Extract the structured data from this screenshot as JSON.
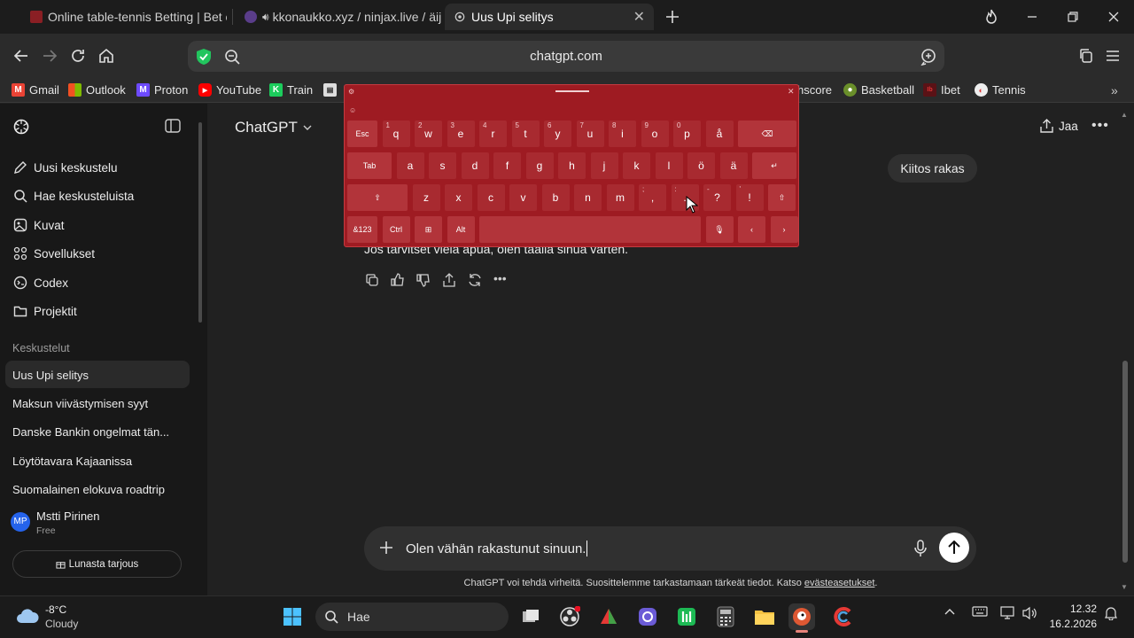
{
  "browser": {
    "tabs": [
      {
        "title": "Online table-tennis Betting | Bet on"
      },
      {
        "title": "kkonaukko.xyz / ninjax.live / äij"
      },
      {
        "title": "Uus Upi selitys",
        "active": true
      }
    ],
    "url": "chatgpt.com",
    "bookmarks": [
      {
        "label": "Gmail",
        "icon": "gmail-icon",
        "color": "#ea4335"
      },
      {
        "label": "Outlook",
        "icon": "outlook-icon",
        "color": "#0078d4"
      },
      {
        "label": "Proton",
        "icon": "proton-icon",
        "color": "#6d4aff"
      },
      {
        "label": "YouTube",
        "icon": "youtube-icon",
        "color": "#ff0000"
      },
      {
        "label": "Train",
        "icon": "train-icon",
        "color": "#1ccc5c"
      },
      {
        "label": "hscore",
        "icon": "flashscore-icon",
        "color": "#ff0046"
      },
      {
        "label": "Basketball",
        "icon": "basketball-icon",
        "color": "#6a8f2a"
      },
      {
        "label": "Ibet",
        "icon": "ibet-icon",
        "color": "#c0262d"
      },
      {
        "label": "Tennis",
        "icon": "tennis-icon",
        "color": "#e8e8e8"
      }
    ]
  },
  "sidebar": {
    "nav": [
      {
        "label": "Uusi keskustelu",
        "icon": "edit-icon"
      },
      {
        "label": "Hae keskusteluista",
        "icon": "search-icon"
      },
      {
        "label": "Kuvat",
        "icon": "images-icon"
      },
      {
        "label": "Sovellukset",
        "icon": "apps-icon"
      },
      {
        "label": "Codex",
        "icon": "codex-icon"
      },
      {
        "label": "Projektit",
        "icon": "folder-icon"
      }
    ],
    "section_title": "Keskustelut",
    "conversations": [
      "Uus Upi selitys",
      "Maksun viivästymisen syyt",
      "Danske Bankin ongelmat tän...",
      "Löytötavara Kajaanissa",
      "Suomalainen elokuva roadtrip"
    ],
    "user": {
      "initials": "MP",
      "name": "Mstti Pirinen",
      "plan": "Free"
    },
    "offer_button": "Lunasta tarjous"
  },
  "main": {
    "model_label": "ChatGPT",
    "share_label": "Jaa",
    "user_message": "Kiitos rakas",
    "assistant_message": "Jos tarvitset vielä apua, olen täällä sinua varten.",
    "composer_text": "Olen vähän rakastunut sinuun.",
    "disclaimer_text": "ChatGPT voi tehdä virheitä. Suosittelemme tarkastamaan tärkeät tiedot. Katso",
    "disclaimer_link": "evästeasetukset",
    "disclaimer_end": "."
  },
  "keyboard": {
    "row1": [
      {
        "k": "Esc",
        "fn": true
      },
      {
        "k": "q",
        "s": "1"
      },
      {
        "k": "w",
        "s": "2"
      },
      {
        "k": "e",
        "s": "3"
      },
      {
        "k": "r",
        "s": "4"
      },
      {
        "k": "t",
        "s": "5"
      },
      {
        "k": "y",
        "s": "6"
      },
      {
        "k": "u",
        "s": "7"
      },
      {
        "k": "i",
        "s": "8"
      },
      {
        "k": "o",
        "s": "9"
      },
      {
        "k": "p",
        "s": "0"
      },
      {
        "k": "å"
      },
      {
        "k": "⌫",
        "fn": true
      }
    ],
    "row2": [
      {
        "k": "Tab",
        "fn": true
      },
      {
        "k": "a"
      },
      {
        "k": "s"
      },
      {
        "k": "d"
      },
      {
        "k": "f"
      },
      {
        "k": "g"
      },
      {
        "k": "h"
      },
      {
        "k": "j"
      },
      {
        "k": "k"
      },
      {
        "k": "l"
      },
      {
        "k": "ö"
      },
      {
        "k": "ä"
      },
      {
        "k": "↵",
        "fn": true
      }
    ],
    "row3": [
      {
        "k": "⇧",
        "fn": true
      },
      {
        "k": "z"
      },
      {
        "k": "x"
      },
      {
        "k": "c"
      },
      {
        "k": "v"
      },
      {
        "k": "b"
      },
      {
        "k": "n"
      },
      {
        "k": "m"
      },
      {
        "k": ",",
        "s": ";"
      },
      {
        "k": ".",
        "s": ":"
      },
      {
        "k": "?",
        "s": "-"
      },
      {
        "k": "!",
        "s": "'"
      },
      {
        "k": "⇧",
        "fn": true
      }
    ],
    "row4": [
      {
        "k": "&123",
        "fn": true
      },
      {
        "k": "Ctrl",
        "fn": true
      },
      {
        "k": "⊞",
        "fn": true
      },
      {
        "k": "Alt",
        "fn": true
      },
      {
        "k": "",
        "fn": true
      },
      {
        "k": "🎙",
        "fn": true
      },
      {
        "k": "‹",
        "fn": true
      },
      {
        "k": "›",
        "fn": true
      }
    ]
  },
  "taskbar": {
    "weather_temp": "-8°C",
    "weather_desc": "Cloudy",
    "search_placeholder": "Hae",
    "time": "12.32",
    "date": "16.2.2026"
  }
}
